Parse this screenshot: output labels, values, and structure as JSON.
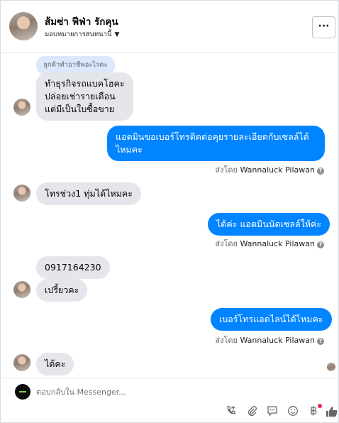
{
  "header": {
    "name": "ส้มซ่า ฟีฟ่า รักคุน",
    "assign_label": "มอบหมายการสนทนานี้",
    "more_label": "···"
  },
  "thread": {
    "reply_quote": "ลูกค้าทำอาชีพอะไรคะ",
    "msg1": [
      "ทำธุรกิจรถแบคโฮคะ",
      "ปล่อยเช่ารายเดือน",
      "แต่มีเป็นใบซื้อขาย"
    ],
    "msg2": "แอดมินขอเบอร์โทรติดต่อคุยรายละเอียดกับเซลล์ได้ไหมคะ",
    "sent_by_prefix": "ส่งโดย",
    "sent_by_name": "Wannaluck Pilawan",
    "msg3": "โทรช่วง1 ทุ่มได้ไหมคะ",
    "msg4": "ได้ค่ะ แอดมินนัดเซลล์ให้ค่ะ",
    "msg5": "0917164230",
    "msg6": "เปรี้ยวคะ",
    "msg7": "เบอร์โทรแอดไลน์ได้ไหมคะ",
    "msg8": "ได้คะ"
  },
  "composer": {
    "placeholder": "ตอบกลับใน Messenger..."
  },
  "colors": {
    "accent": "#0084ff",
    "incoming_bubble": "#e4e6eb"
  }
}
